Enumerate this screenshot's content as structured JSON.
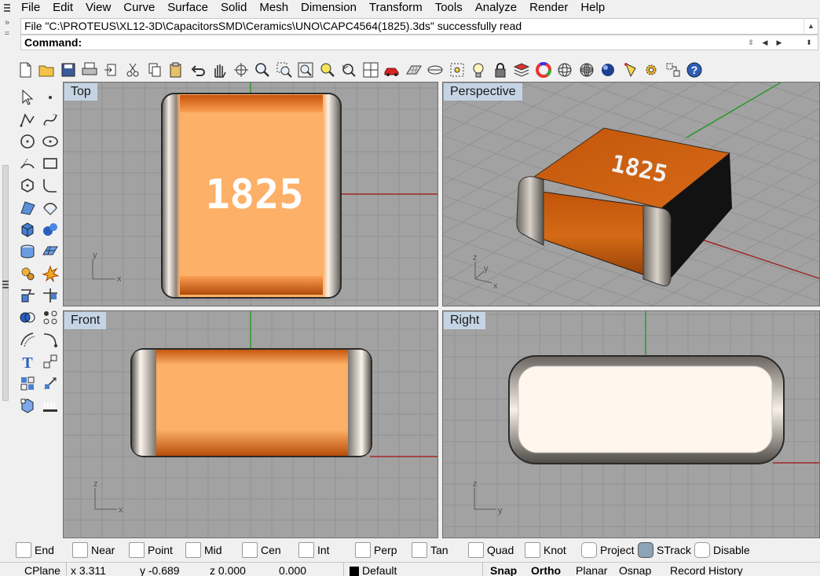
{
  "menu": [
    "File",
    "Edit",
    "View",
    "Curve",
    "Surface",
    "Solid",
    "Mesh",
    "Dimension",
    "Transform",
    "Tools",
    "Analyze",
    "Render",
    "Help"
  ],
  "command": {
    "history": "File \"C:\\PROTEUS\\XL12-3D\\CapacitorsSMD\\Ceramics\\UNO\\CAPC4564(1825).3ds\" successfully read",
    "prompt_label": "Command:",
    "value": ""
  },
  "toolbar_icons": [
    "new-document-icon",
    "open-folder-icon",
    "save-icon",
    "print-icon",
    "import-icon",
    "cut-icon",
    "copy-icon",
    "paste-icon",
    "undo-icon",
    "pan-hand-icon",
    "rotate-view-icon",
    "zoom-icon",
    "zoom-window-icon",
    "zoom-extents-icon",
    "zoom-selected-icon",
    "undo-view-icon",
    "four-viewports-icon",
    "car-shade-icon",
    "grid-plane-icon",
    "cplane-icon",
    "point-snap-icon",
    "light-bulb-icon",
    "lock-icon",
    "layer-icon",
    "color-wheel-icon",
    "sphere-wireframe-icon",
    "sphere-mesh-icon",
    "render-sphere-icon",
    "spotlight-icon",
    "options-gear-icon",
    "properties-icon",
    "help-icon"
  ],
  "left_tools": [
    "select-arrow-icon",
    "point-icon",
    "polyline-icon",
    "curve-icon",
    "circle-icon",
    "ellipse-icon",
    "arc-icon",
    "rectangle-icon",
    "polygon-icon",
    "fillet-curve-icon",
    "surface-corner-icon",
    "surface-patch-icon",
    "box-solid-icon",
    "spheres-icon",
    "cylinder-icon",
    "mesh-surface-icon",
    "gear-tool-icon",
    "explode-icon",
    "split-icon",
    "trim-icon",
    "boolean-icon",
    "array-icon",
    "offset-icon",
    "fillet-icon",
    "text-icon",
    "scale-icon",
    "group-icon",
    "dimension-icon",
    "block-icon",
    "layout-icon"
  ],
  "viewports": {
    "top": {
      "label": "Top",
      "marking": "1825",
      "axis1": "y",
      "axis2": "x"
    },
    "perspective": {
      "label": "Perspective",
      "marking": "1825",
      "axis1": "z",
      "axis2": "y",
      "axis3": "x"
    },
    "front": {
      "label": "Front",
      "axis1": "z",
      "axis2": "x"
    },
    "right": {
      "label": "Right",
      "axis1": "z",
      "axis2": "y"
    }
  },
  "osnaps": [
    {
      "label": "End",
      "checked": false
    },
    {
      "label": "Near",
      "checked": false
    },
    {
      "label": "Point",
      "checked": false
    },
    {
      "label": "Mid",
      "checked": false
    },
    {
      "label": "Cen",
      "checked": false
    },
    {
      "label": "Int",
      "checked": false
    },
    {
      "label": "Perp",
      "checked": false
    },
    {
      "label": "Tan",
      "checked": false
    },
    {
      "label": "Quad",
      "checked": false
    },
    {
      "label": "Knot",
      "checked": false
    },
    {
      "label": "Project",
      "checked": false
    },
    {
      "label": "STrack",
      "checked": true
    },
    {
      "label": "Disable",
      "checked": false
    }
  ],
  "status": {
    "cplane": "CPlane",
    "x": "x 3.311",
    "y": "y -0.689",
    "z": "z 0.000",
    "dist": "0.000",
    "layer": "Default",
    "layer_color": "#000000",
    "snap": "Snap",
    "ortho": "Ortho",
    "planar": "Planar",
    "osnap": "Osnap",
    "record_history": "Record History"
  },
  "colors": {
    "viewport_bg": "#a2a2a2",
    "grid": "#8e8e8e",
    "axis_x": "#a02828",
    "axis_y": "#2a9a2a",
    "body_orange": "#c7560c",
    "body_light": "#fdb068",
    "label_blue": "#c4d4e4"
  }
}
